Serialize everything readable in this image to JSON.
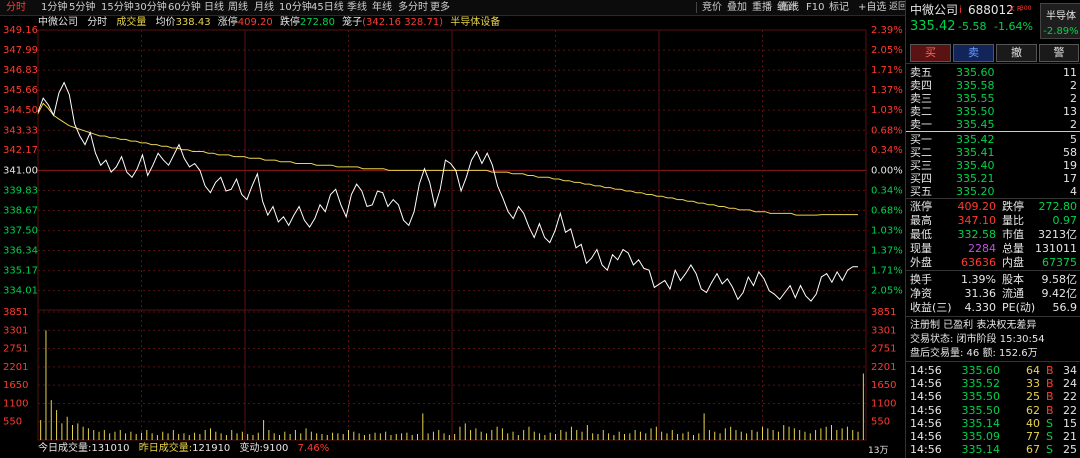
{
  "toolbar": {
    "left_items": [
      "分时",
      "1分钟",
      "5分钟",
      "15分钟",
      "30分钟",
      "60分钟",
      "日线",
      "周线",
      "月线",
      "10分钟",
      "45日线",
      "季线",
      "年线",
      "多分时",
      "更多"
    ],
    "right_items": [
      "竞价",
      "叠加",
      "重播",
      "统计",
      "画线",
      "F10",
      "标记",
      "+自选",
      "返回"
    ],
    "active": "分时"
  },
  "chart_header": {
    "stock": "中微公司",
    "mode": "分时",
    "volume_label": "成交量",
    "avg_label": "均价",
    "avg_value": "338.43",
    "limit_up_label": "涨停",
    "limit_up_value": "409.20",
    "limit_down_label": "跌停",
    "limit_down_value": "272.80",
    "cage_label": "笼子",
    "cage_values": "(342.16 328.71)",
    "sector": "半导体设备"
  },
  "chart_data": {
    "type": "line",
    "prev_close": 341.0,
    "price_ticks": [
      "349.16",
      "347.99",
      "346.83",
      "345.66",
      "344.50",
      "343.33",
      "342.17",
      "341.00",
      "339.83",
      "338.67",
      "337.50",
      "336.34",
      "335.17",
      "334.01"
    ],
    "pct_ticks": [
      "2.39%",
      "2.05%",
      "1.71%",
      "1.37%",
      "1.03%",
      "0.68%",
      "0.34%",
      "0.00%",
      "0.34%",
      "0.68%",
      "1.03%",
      "1.37%",
      "1.71%",
      "2.05%"
    ],
    "ylim": [
      333.0,
      349.16
    ],
    "price_series": [
      344.4,
      345.2,
      344.8,
      344.2,
      345.5,
      346.1,
      345.4,
      343.7,
      343.0,
      342.5,
      343.2,
      342.0,
      341.3,
      341.6,
      340.9,
      341.2,
      341.8,
      340.9,
      340.6,
      341.1,
      341.9,
      340.7,
      341.3,
      342.0,
      341.6,
      341.3,
      341.9,
      342.5,
      341.7,
      341.2,
      341.4,
      341.0,
      340.1,
      339.7,
      340.3,
      340.6,
      339.8,
      339.9,
      340.5,
      339.6,
      339.3,
      340.1,
      340.8,
      339.2,
      338.4,
      338.9,
      338.0,
      338.3,
      337.8,
      338.4,
      338.9,
      338.1,
      337.7,
      338.2,
      339.0,
      338.6,
      339.6,
      339.9,
      339.0,
      338.3,
      339.6,
      340.2,
      339.8,
      338.9,
      339.0,
      339.8,
      339.7,
      338.9,
      339.3,
      339.0,
      338.1,
      337.8,
      338.6,
      340.2,
      341.1,
      340.3,
      338.9,
      339.9,
      341.6,
      341.4,
      341.0,
      339.8,
      340.6,
      341.6,
      342.1,
      341.4,
      342.0,
      341.3,
      340.1,
      339.4,
      338.6,
      338.2,
      338.9,
      338.5,
      337.7,
      337.1,
      337.9,
      337.1,
      336.8,
      337.5,
      338.5,
      337.4,
      337.6,
      336.5,
      336.7,
      335.6,
      335.9,
      336.4,
      335.5,
      335.2,
      336.1,
      335.8,
      336.4,
      336.2,
      335.5,
      335.8,
      335.3,
      335.2,
      334.2,
      334.4,
      334.6,
      334.1,
      335.2,
      334.6,
      335.0,
      335.5,
      335.0,
      334.1,
      333.9,
      334.5,
      335.0,
      334.4,
      334.7,
      334.2,
      333.5,
      333.9,
      334.8,
      334.3,
      335.1,
      334.7,
      334.0,
      333.8,
      333.5,
      333.9,
      334.3,
      333.6,
      334.3,
      333.7,
      333.4,
      333.8,
      334.8,
      335.0,
      334.5,
      335.1,
      334.6,
      335.2,
      335.4,
      335.4
    ],
    "avg_series": [
      344.3,
      344.9,
      344.6,
      344.2,
      344.0,
      343.8,
      343.6,
      343.5,
      343.4,
      343.3,
      343.2,
      343.1,
      343.0,
      343.0,
      342.9,
      342.9,
      342.8,
      342.8,
      342.7,
      342.7,
      342.6,
      342.6,
      342.5,
      342.5,
      342.4,
      342.4,
      342.3,
      342.3,
      342.2,
      342.2,
      342.1,
      342.1,
      342.1,
      342.0,
      342.0,
      341.9,
      341.9,
      341.9,
      341.8,
      341.8,
      341.8,
      341.7,
      341.7,
      341.7,
      341.6,
      341.6,
      341.6,
      341.5,
      341.5,
      341.5,
      341.4,
      341.4,
      341.4,
      341.4,
      341.3,
      341.3,
      341.3,
      341.3,
      341.2,
      341.2,
      341.2,
      341.2,
      341.2,
      341.1,
      341.1,
      341.1,
      341.1,
      341.1,
      341.0,
      341.0,
      341.0,
      341.0,
      341.0,
      341.0,
      341.0,
      341.0,
      341.0,
      341.0,
      341.0,
      341.0,
      341.0,
      341.0,
      341.0,
      341.0,
      341.0,
      341.0,
      341.0,
      341.0,
      340.9,
      340.9,
      340.9,
      340.9,
      340.8,
      340.8,
      340.8,
      340.7,
      340.7,
      340.6,
      340.6,
      340.6,
      340.5,
      340.5,
      340.4,
      340.4,
      340.3,
      340.3,
      340.2,
      340.2,
      340.1,
      340.1,
      340.0,
      340.0,
      339.9,
      339.9,
      339.8,
      339.8,
      339.7,
      339.7,
      339.6,
      339.6,
      339.5,
      339.5,
      339.4,
      339.4,
      339.3,
      339.3,
      339.2,
      339.2,
      339.1,
      339.1,
      339.0,
      339.0,
      338.9,
      338.9,
      338.8,
      338.8,
      338.7,
      338.7,
      338.7,
      338.6,
      338.6,
      338.6,
      338.5,
      338.5,
      338.5,
      338.5,
      338.5,
      338.4,
      338.4,
      338.4,
      338.4,
      338.4,
      338.43,
      338.43,
      338.43,
      338.43,
      338.43,
      338.43,
      338.43,
      338.43
    ],
    "volume_ticks": [
      "3851",
      "3301",
      "2751",
      "2201",
      "1650",
      "1100",
      "550"
    ],
    "volume_max": 3851,
    "volumes": [
      600,
      3300,
      1200,
      900,
      500,
      700,
      450,
      500,
      400,
      350,
      300,
      250,
      300,
      200,
      250,
      300,
      200,
      250,
      180,
      220,
      300,
      200,
      150,
      250,
      200,
      300,
      180,
      200,
      150,
      220,
      180,
      300,
      350,
      250,
      200,
      150,
      300,
      200,
      250,
      180,
      150,
      220,
      600,
      300,
      200,
      150,
      250,
      180,
      300,
      200,
      350,
      250,
      200,
      180,
      150,
      220,
      200,
      180,
      300,
      250,
      200,
      150,
      180,
      220,
      200,
      250,
      150,
      180,
      200,
      220,
      150,
      180,
      800,
      200,
      250,
      300,
      200,
      150,
      180,
      400,
      500,
      300,
      350,
      250,
      200,
      300,
      400,
      350,
      200,
      250,
      150,
      300,
      400,
      250,
      200,
      150,
      220,
      180,
      300,
      250,
      400,
      300,
      250,
      450,
      200,
      180,
      300,
      200,
      150,
      250,
      180,
      200,
      300,
      250,
      200,
      350,
      400,
      250,
      200,
      300,
      180,
      200,
      250,
      150,
      200,
      800,
      300,
      250,
      200,
      350,
      400,
      300,
      250,
      200,
      300,
      250,
      400,
      350,
      300,
      250,
      450,
      400,
      350,
      300,
      250,
      200,
      300,
      350,
      400,
      450,
      300,
      350,
      400,
      300,
      250,
      2000
    ]
  },
  "volume_footer": {
    "today_label": "今日成交量:",
    "today_value": "131010",
    "yesterday_label": "昨日成交量:",
    "yesterday_value": "121910",
    "change_label": "变动:",
    "change_value": "9100",
    "change_pct": "7.46%",
    "unit": "13万"
  },
  "panel": {
    "name": "中微公司",
    "badge": "i",
    "code": "688012",
    "kr": "K R",
    "kr_sub": "300",
    "sector_btn": "半导体",
    "sector_pct": "-2.89%",
    "price": "335.42",
    "change": "-5.58",
    "change_pct": "-1.64%",
    "buttons": [
      "买",
      "卖",
      "撤",
      "警"
    ],
    "asks": [
      {
        "label": "卖五",
        "price": "335.60",
        "vol": "11"
      },
      {
        "label": "卖四",
        "price": "335.58",
        "vol": "2"
      },
      {
        "label": "卖三",
        "price": "335.55",
        "vol": "2"
      },
      {
        "label": "卖二",
        "price": "335.50",
        "vol": "13"
      },
      {
        "label": "卖一",
        "price": "335.45",
        "vol": "2"
      }
    ],
    "bids": [
      {
        "label": "买一",
        "price": "335.42",
        "vol": "5"
      },
      {
        "label": "买二",
        "price": "335.41",
        "vol": "58"
      },
      {
        "label": "买三",
        "price": "335.40",
        "vol": "19"
      },
      {
        "label": "买四",
        "price": "335.21",
        "vol": "17"
      },
      {
        "label": "买五",
        "price": "335.20",
        "vol": "4"
      }
    ],
    "stats": [
      {
        "l1": "涨停",
        "v1": "409.20",
        "c1": "red",
        "l2": "跌停",
        "v2": "272.80",
        "c2": "green"
      },
      {
        "l1": "最高",
        "v1": "347.10",
        "c1": "red",
        "l2": "量比",
        "v2": "0.97",
        "c2": "green"
      },
      {
        "l1": "最低",
        "v1": "332.58",
        "c1": "green",
        "l2": "市值",
        "v2": "3213亿",
        "c2": "white"
      },
      {
        "l1": "现量",
        "v1": "2284",
        "c1": "purple",
        "l2": "总量",
        "v2": "131011",
        "c2": "white"
      },
      {
        "l1": "外盘",
        "v1": "63636",
        "c1": "red",
        "l2": "内盘",
        "v2": "67375",
        "c2": "green"
      }
    ],
    "fundamentals": [
      {
        "l1": "换手",
        "v1": "1.39%",
        "l2": "股本",
        "v2": "9.58亿"
      },
      {
        "l1": "净资",
        "v1": "31.36",
        "l2": "流通",
        "v2": "9.42亿"
      },
      {
        "l1": "收益(三)",
        "v1": "4.330",
        "l2": "PE(动)",
        "v2": "56.9"
      }
    ],
    "tags": "注册制 已盈利 表决权无差异",
    "trade_status": "交易状态: 闭市阶段 15:30:54",
    "after_hours": "盘后交易量: 46  额: 152.6万",
    "ticks": [
      {
        "time": "14:56",
        "price": "335.60",
        "vol": "64",
        "side": "B",
        "count": "34"
      },
      {
        "time": "14:56",
        "price": "335.52",
        "vol": "33",
        "side": "B",
        "count": "24"
      },
      {
        "time": "14:56",
        "price": "335.50",
        "vol": "25",
        "side": "B",
        "count": "22"
      },
      {
        "time": "14:56",
        "price": "335.50",
        "vol": "62",
        "side": "B",
        "count": "22"
      },
      {
        "time": "14:56",
        "price": "335.14",
        "vol": "40",
        "side": "S",
        "count": "15"
      },
      {
        "time": "14:56",
        "price": "335.09",
        "vol": "77",
        "side": "S",
        "count": "21"
      },
      {
        "time": "14:56",
        "price": "335.14",
        "vol": "67",
        "side": "S",
        "count": "25"
      }
    ]
  },
  "colors": {
    "up": "#ff3b30",
    "down": "#00d24a",
    "avg": "#e8d44d",
    "price": "#ffffff",
    "grid": "#5a1010"
  }
}
